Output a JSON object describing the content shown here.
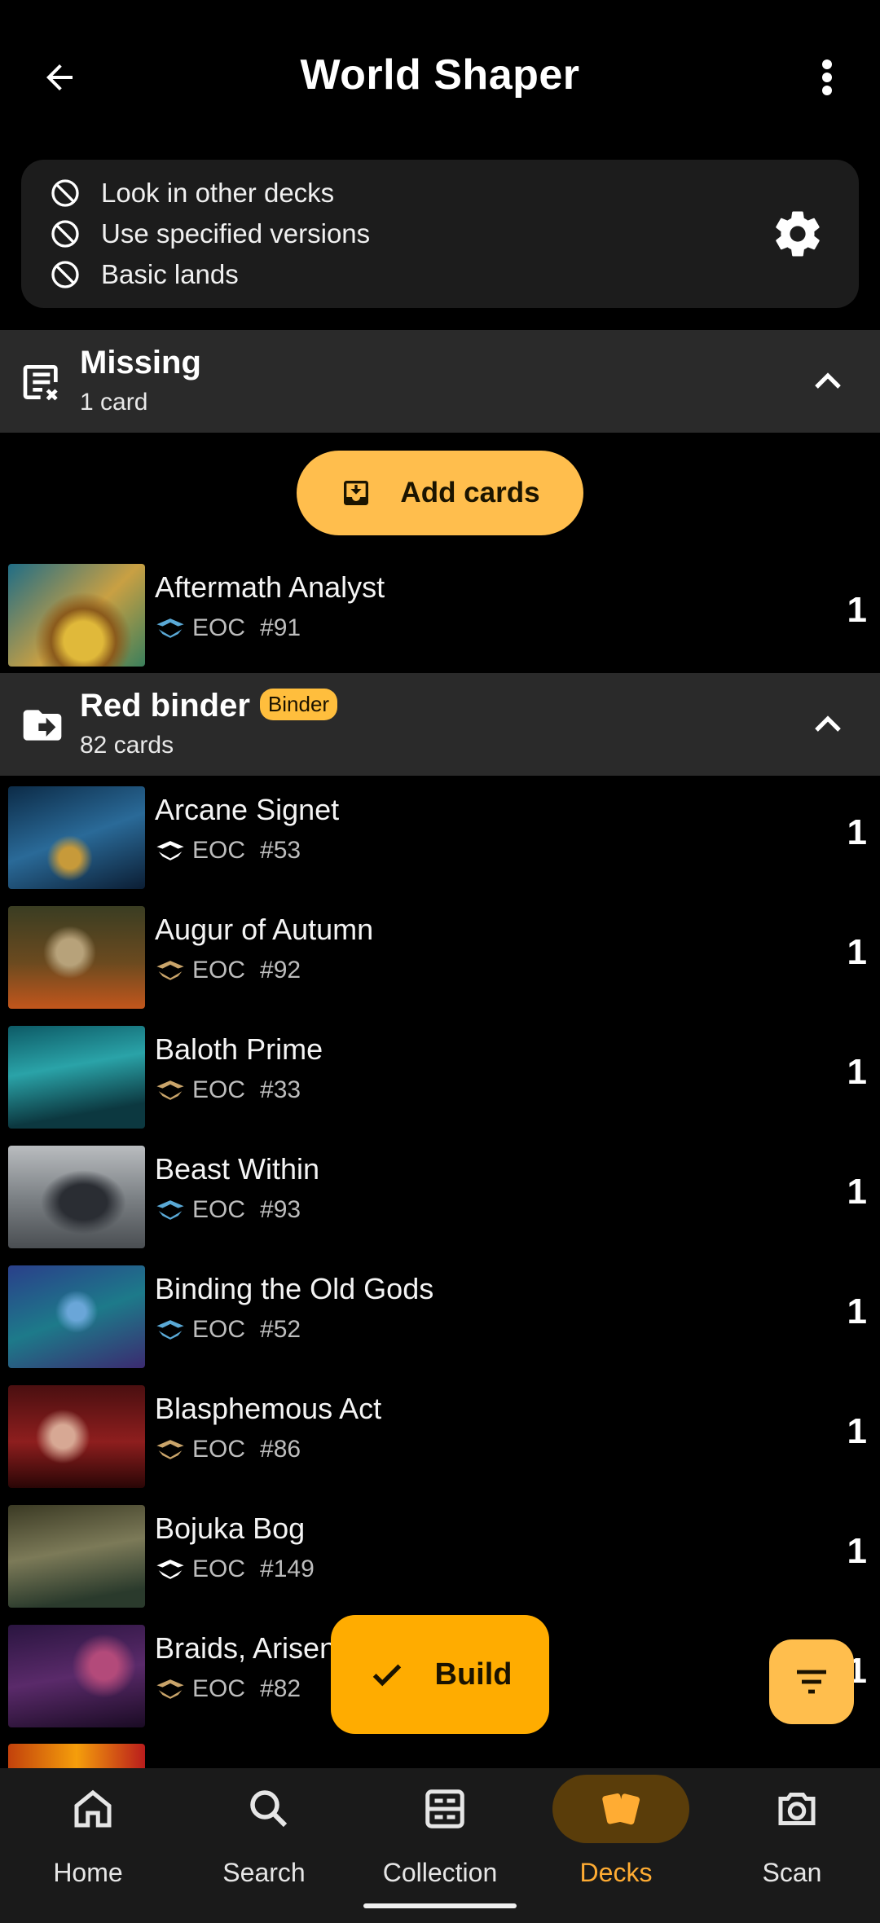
{
  "header": {
    "title": "World Shaper",
    "back_icon": "arrow-left-icon",
    "menu_icon": "more-vertical-icon"
  },
  "options": {
    "items": [
      {
        "label": "Look in other decks",
        "icon": "block-icon"
      },
      {
        "label": "Use specified versions",
        "icon": "block-icon"
      },
      {
        "label": "Basic lands",
        "icon": "block-icon"
      }
    ],
    "settings_icon": "gear-icon"
  },
  "missing": {
    "title": "Missing",
    "subtitle": "1 card",
    "icon": "list-remove-icon"
  },
  "add_cards": {
    "label": "Add cards",
    "icon": "inbox-download-icon"
  },
  "missing_cards": [
    {
      "name": "Aftermath Analyst",
      "set": "EOC",
      "number": "#91",
      "qty": "1",
      "rarity_color": "#5aa9d6"
    }
  ],
  "binder": {
    "title": "Red binder",
    "badge": "Binder",
    "subtitle": "82 cards",
    "icon": "folder-move-icon"
  },
  "binder_cards": [
    {
      "name": "Arcane Signet",
      "set": "EOC",
      "number": "#53",
      "qty": "1",
      "rarity_color": "#ffffff"
    },
    {
      "name": "Augur of Autumn",
      "set": "EOC",
      "number": "#92",
      "qty": "1",
      "rarity_color": "#c9a46a"
    },
    {
      "name": "Baloth Prime",
      "set": "EOC",
      "number": "#33",
      "qty": "1",
      "rarity_color": "#c9a46a"
    },
    {
      "name": "Beast Within",
      "set": "EOC",
      "number": "#93",
      "qty": "1",
      "rarity_color": "#5aa9d6"
    },
    {
      "name": "Binding the Old Gods",
      "set": "EOC",
      "number": "#52",
      "qty": "1",
      "rarity_color": "#5aa9d6"
    },
    {
      "name": "Blasphemous Act",
      "set": "EOC",
      "number": "#86",
      "qty": "1",
      "rarity_color": "#c9a46a"
    },
    {
      "name": "Bojuka Bog",
      "set": "EOC",
      "number": "#149",
      "qty": "1",
      "rarity_color": "#ffffff"
    },
    {
      "name": "Braids, Arisen",
      "set": "EOC",
      "number": "#82",
      "qty": "1",
      "rarity_color": "#c9a46a"
    }
  ],
  "fab": {
    "build_label": "Build",
    "build_icon": "check-icon",
    "sort_icon": "sort-icon"
  },
  "nav": [
    {
      "label": "Home",
      "icon": "home-icon",
      "active": false
    },
    {
      "label": "Search",
      "icon": "search-icon",
      "active": false
    },
    {
      "label": "Collection",
      "icon": "collection-icon",
      "active": false
    },
    {
      "label": "Decks",
      "icon": "cards-icon",
      "active": true
    },
    {
      "label": "Scan",
      "icon": "camera-icon",
      "active": false
    }
  ],
  "colors": {
    "accent": "#ffac00",
    "accent_soft": "#ffbe4d",
    "surface": "#1c1c1c",
    "section": "#2a2a2a"
  }
}
